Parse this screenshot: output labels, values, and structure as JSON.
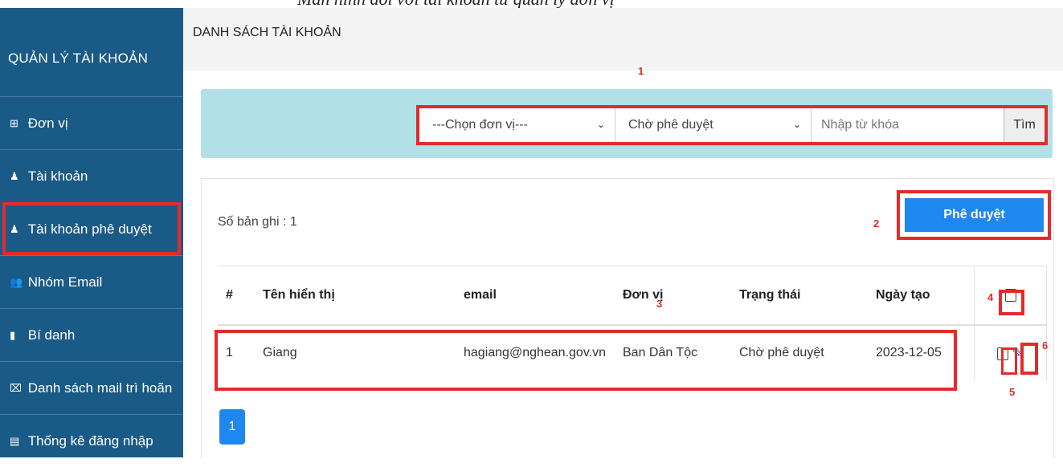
{
  "caption": "Màn hình đối với tài khoản từ quản lý đơn vị",
  "sidebar": {
    "title": "QUẢN LÝ TÀI KHOẢN",
    "items": [
      {
        "icon": "⊞",
        "label": "Đơn vị"
      },
      {
        "icon": "♟",
        "label": "Tài khoản"
      },
      {
        "icon": "♟",
        "label": "Tài khoản phê duyệt"
      },
      {
        "icon": "👥",
        "label": "Nhóm Email"
      },
      {
        "icon": "▮",
        "label": "Bí danh"
      },
      {
        "icon": "⌧",
        "label": "Danh sách mail trì hoãn"
      },
      {
        "icon": "▤",
        "label": "Thống kê đăng nhập"
      }
    ]
  },
  "header": {
    "title": "DANH SÁCH TÀI KHOẢN"
  },
  "annotations": {
    "a1": "1",
    "a2": "2",
    "a3": "3",
    "a4": "4",
    "a5": "5",
    "a6": "6"
  },
  "filter": {
    "unit_select": "---Chọn đơn vị---",
    "status_select": "Chờ phê duyệt",
    "keyword_placeholder": "Nhập từ khóa",
    "search_label": "Tìm"
  },
  "list": {
    "count_text": "Số bản ghi : 1",
    "approve_label": "Phê duyệt",
    "columns": [
      "#",
      "Tên hiển thị",
      "email",
      "Đơn vị",
      "Trạng thái",
      "Ngày tạo"
    ],
    "rows": [
      {
        "index": "1",
        "name": "Giang",
        "email": "hagiang@nghean.gov.vn",
        "unit": "Ban Dân Tộc",
        "status": "Chờ phê duyệt",
        "created": "2023-12-05"
      }
    ],
    "edit_icon": "✎"
  },
  "pagination": {
    "current": "1"
  },
  "colors": {
    "sidebar": "#1a5a86",
    "accent": "#1f87f0",
    "highlight": "#e32b2b",
    "filterbar": "#b2e0e7"
  }
}
